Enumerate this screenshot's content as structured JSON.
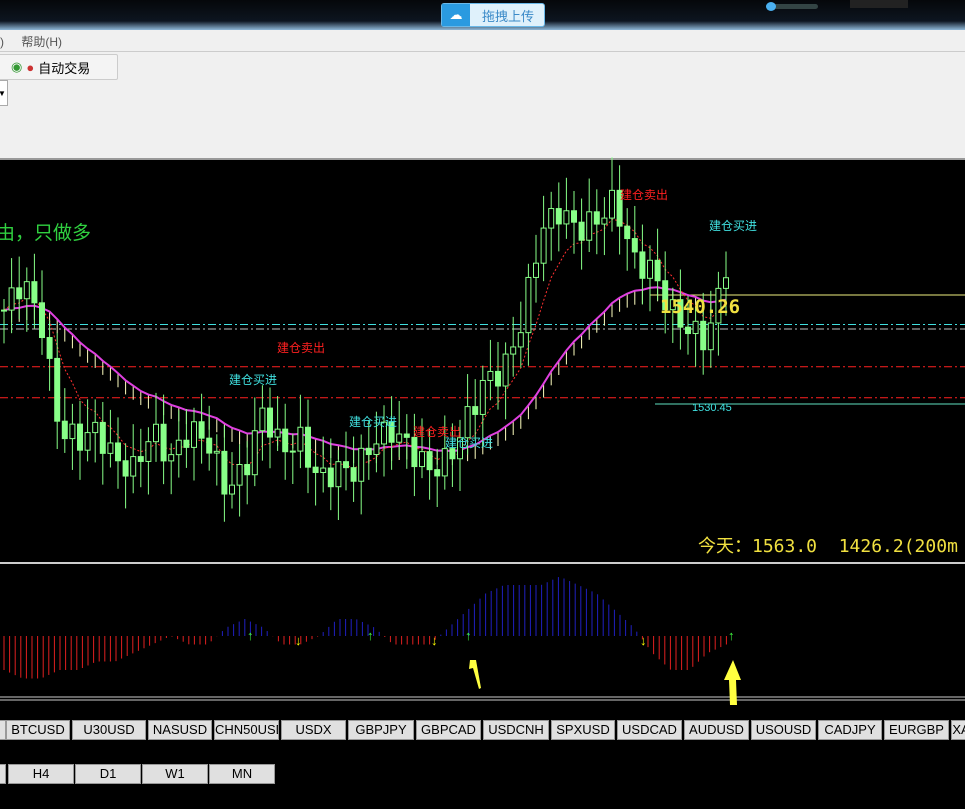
{
  "topbar": {
    "upload_label": "拖拽上传",
    "upload_icon": "cloud-upload-icon"
  },
  "menu": {
    "help": "帮助(H)",
    "prev_fragment": ")"
  },
  "toolbar": {
    "auto_trade": "自动交易"
  },
  "chart": {
    "banner": "由，只做多",
    "price_label": "1540.26",
    "ma_label": "1530.45",
    "today_text": "今天：1563.0  1426.2(200m",
    "signals": [
      {
        "text": "建仓卖出",
        "type": "sell"
      },
      {
        "text": "建仓卖出",
        "type": "sell"
      },
      {
        "text": "建仓卖出",
        "type": "sell"
      },
      {
        "text": "建仓买进",
        "type": "buy"
      },
      {
        "text": "建仓买进",
        "type": "buy"
      },
      {
        "text": "建仓买进",
        "type": "buy"
      },
      {
        "text": "建仓买进",
        "type": "buy"
      }
    ],
    "colors": {
      "up": "#88ff88",
      "sell": "#ff2020",
      "buy": "#40e0e0",
      "label": "#f0e040",
      "osc_neg": "#e02020",
      "osc_pos": "#2020c0"
    },
    "closes": [
      1538.9,
      1541.6,
      1538.0,
      1528.1,
      1527.2,
      1528.1,
      1525.4,
      1524.5,
      1528.1,
      1525.4,
      1528.1,
      1527.2,
      1522.7,
      1524.5,
      1529.9,
      1526.3,
      1527.2,
      1523.6,
      1524.5,
      1524.5,
      1527.2,
      1528.1,
      1526.3,
      1524.5,
      1525.4,
      1529.0,
      1532.6,
      1533.5,
      1538.0,
      1546.1,
      1547.9,
      1546.1,
      1547.0,
      1548.8,
      1543.4,
      1542.5,
      1538.9,
      1537.1,
      1536.2,
      1543.0
    ],
    "osc": [
      -4,
      -5,
      -5,
      -4,
      -4,
      -3,
      -3,
      -2,
      -1,
      0,
      -1,
      -1,
      1,
      2,
      1,
      -1,
      -1,
      0,
      2,
      2,
      1,
      -1,
      -1,
      -1,
      1,
      3,
      5,
      6,
      6,
      6,
      7,
      6,
      5,
      3,
      1,
      -2,
      -4,
      -4,
      -2,
      -1
    ]
  },
  "symbols": [
    "BTCUSD",
    "U30USD",
    "NASUSD",
    "CHN50USD",
    "USDX",
    "GBPJPY",
    "GBPCAD",
    "USDCNH",
    "SPXUSD",
    "USDCAD",
    "AUDUSD",
    "USOUSD",
    "CADJPY",
    "EURGBP",
    "XA"
  ],
  "timeframes": [
    "H4",
    "D1",
    "W1",
    "MN"
  ]
}
